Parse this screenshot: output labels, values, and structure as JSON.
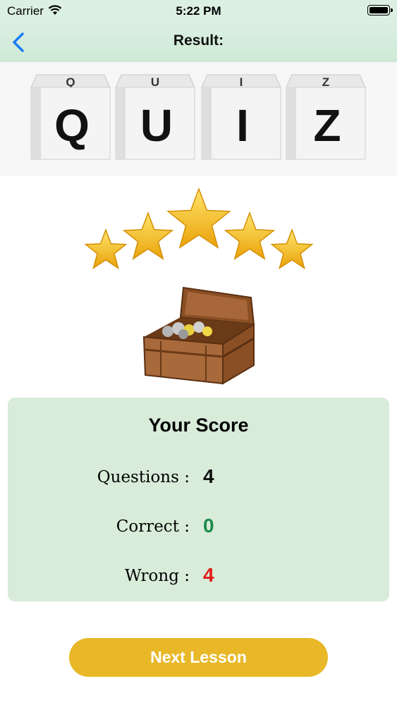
{
  "status_bar": {
    "carrier": "Carrier",
    "time": "5:22 PM"
  },
  "nav": {
    "title": "Result:",
    "back_icon": "chevron-left-icon"
  },
  "banner": {
    "cubes": [
      {
        "top": "Q",
        "front": "Q"
      },
      {
        "top": "U",
        "front": "U"
      },
      {
        "top": "I",
        "front": "I"
      },
      {
        "top": "Z",
        "front": "Z"
      }
    ]
  },
  "rating": {
    "stars": 5
  },
  "score": {
    "title": "Your Score",
    "questions_label": "Questions :",
    "questions_value": "4",
    "correct_label": "Correct :",
    "correct_value": "0",
    "wrong_label": "Wrong :",
    "wrong_value": "4"
  },
  "colors": {
    "accent": "#e8b829",
    "card": "#d8ecd9",
    "nav": "#dcf0e2",
    "back": "#1a7cf5",
    "correct": "#1c8c4a",
    "wrong": "#e01b1b"
  },
  "next_button": {
    "label": "Next Lesson"
  }
}
